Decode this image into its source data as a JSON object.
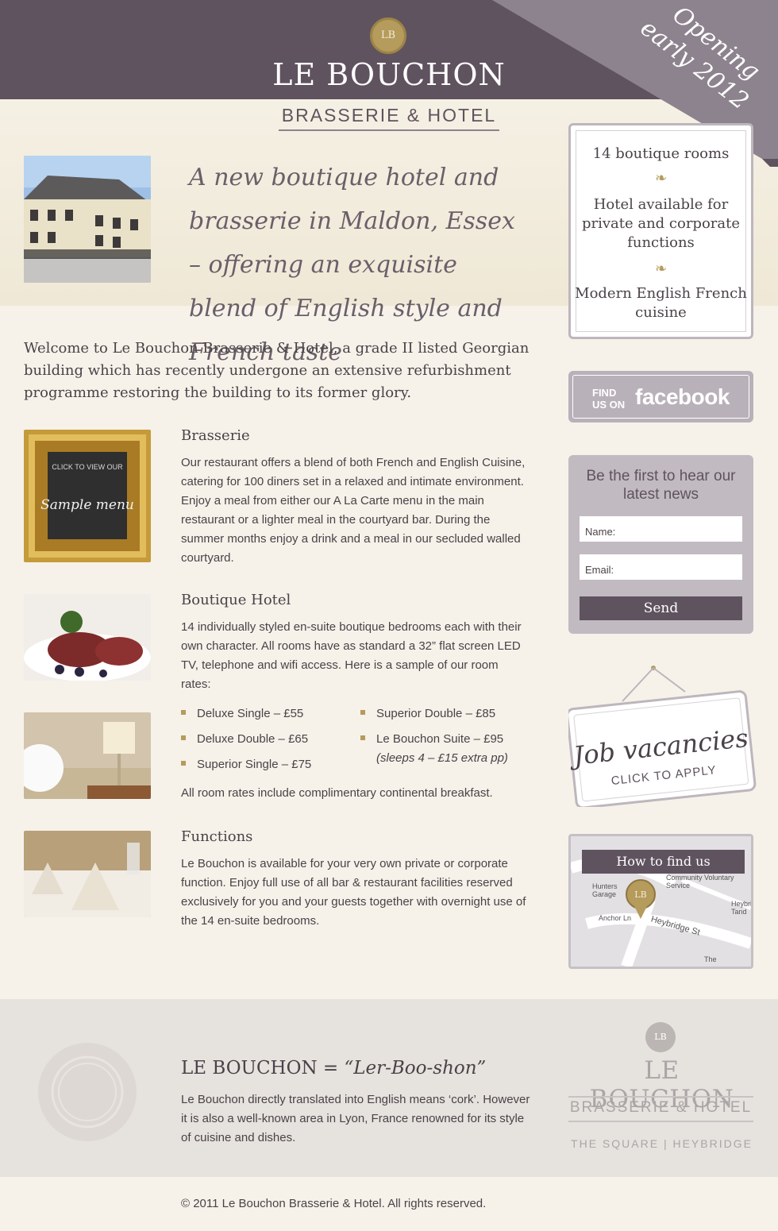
{
  "header": {
    "badge": "LB",
    "title": "LE BOUCHON",
    "subtitle": "BRASSERIE & HOTEL",
    "ribbon": {
      "line1": "Opening",
      "line2": "early 2012"
    }
  },
  "hero": {
    "tagline": "A new boutique hotel and brasserie in Maldon, Essex – offering an exquisite blend of English style and French taste"
  },
  "features": {
    "item1": "14 boutique rooms",
    "item2": "Hotel available for private and corporate functions",
    "item3": "Modern English French cuisine",
    "divider": "❧"
  },
  "facebook": {
    "find": "FIND US ON",
    "brand": "facebook"
  },
  "newsletter": {
    "title": "Be the first to hear our latest news",
    "name_label": "Name:",
    "email_label": "Email:",
    "send": "Send"
  },
  "jobs": {
    "title": "Job vacancies",
    "cta": "CLICK TO APPLY"
  },
  "map": {
    "title": "How to find us",
    "labels": [
      "Hunters Garage",
      "Community Voluntary Service",
      "Anchor Ln",
      "Heybridge St",
      "Heybri Tand",
      "The"
    ]
  },
  "intro": "Welcome to Le Bouchon Brasserie & Hotel, a grade II listed Georgian building which has recently undergone an extensive refurbishment programme restoring the building to its former glory.",
  "brasserie": {
    "title": "Brasserie",
    "body": "Our restaurant offers a blend of both French and English Cuisine, catering for 100 diners set in a relaxed and intimate environment. Enjoy a meal from either our A La Carte menu in the main restaurant or a lighter meal in the courtyard bar. During the summer months enjoy a drink and a meal in our secluded walled courtyard.",
    "menu_click": "CLICK TO VIEW OUR",
    "menu_script": "Sample menu"
  },
  "hotel": {
    "title": "Boutique Hotel",
    "body": "14 individually styled en-suite boutique bedrooms each with their own character. All rooms have as standard a 32” flat screen LED TV, telephone and wifi access. Here is a sample of our room rates:",
    "rates_left": [
      "Deluxe Single – £55",
      "Deluxe Double – £65",
      "Superior Single – £75"
    ],
    "rates_right": [
      "Superior Double – £85",
      "Le Bouchon Suite – £95"
    ],
    "rate_note": "(sleeps 4 – £15 extra pp)",
    "rates_footer": "All room rates include complimentary continental breakfast."
  },
  "functions": {
    "title": "Functions",
    "body": "Le Bouchon is available for your very own private or corporate function. Enjoy full use of all bar & restaurant facilities reserved exclusively for you and your guests together with overnight use of the 14 en-suite bedrooms."
  },
  "footer": {
    "pron_name": "LE BOUCHON",
    "pron_eq": "= “Ler-Boo-shon”",
    "pron_body": "Le Bouchon directly translated into English means ‘cork’. However it is also a well-known area in Lyon, France renowned for its style of cuisine and dishes.",
    "badge": "LB",
    "title": "LE BOUCHON",
    "subtitle": "BRASSERIE & HOTEL",
    "address": "THE SQUARE | HEYBRIDGE",
    "copyright": "© 2011 Le Bouchon Brasserie & Hotel. All rights reserved."
  }
}
